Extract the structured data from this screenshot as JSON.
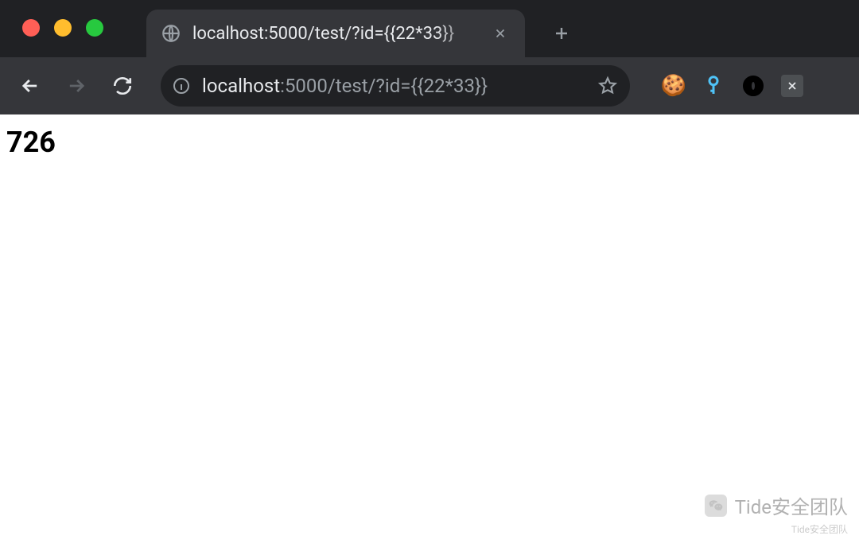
{
  "window": {
    "traffic_lights": {
      "close": "#ff5f56",
      "minimize": "#ffbd2e",
      "maximize": "#27c93f"
    }
  },
  "tab": {
    "title": "localhost:5000/test/?id={{22*33}}"
  },
  "address_bar": {
    "scheme_icon": "info-icon",
    "host": "localhost",
    "port_and_path": ":5000/test/?id={{22*33}}"
  },
  "extensions": {
    "cookie_emoji": "🍪"
  },
  "page": {
    "body_text": "726"
  },
  "watermark": {
    "main": "Tide安全团队",
    "sub": "Tide安全团队"
  }
}
